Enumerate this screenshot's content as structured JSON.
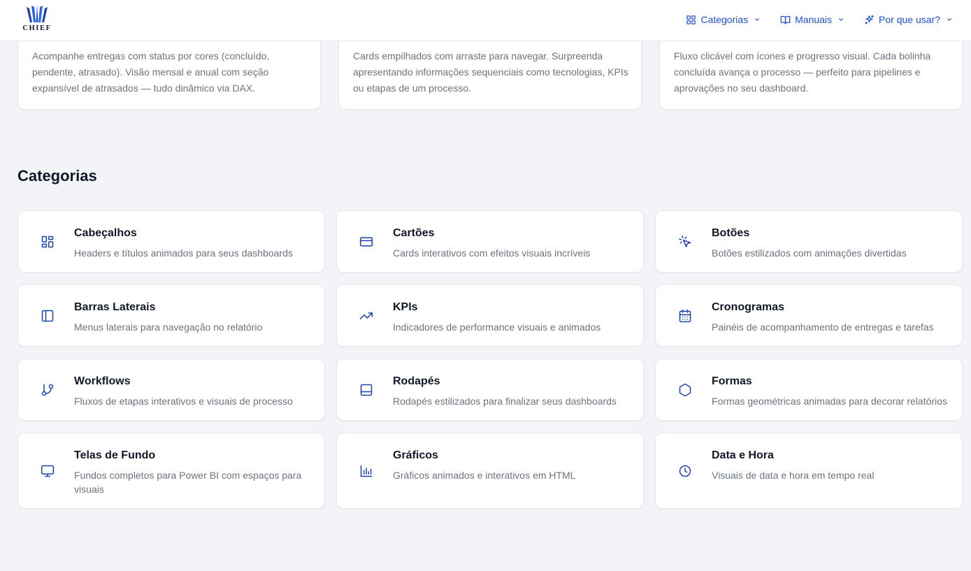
{
  "brand": {
    "name": "CHIEF",
    "color": "#1d4ed8"
  },
  "nav": {
    "items": [
      {
        "label": "Categorias",
        "icon": "grid-icon"
      },
      {
        "label": "Manuais",
        "icon": "book-open-icon"
      },
      {
        "label": "Por que usar?",
        "icon": "sparkles-icon"
      }
    ]
  },
  "features": [
    {
      "text": "Acompanhe entregas com status por cores (concluído, pendente, atrasado). Visão mensal e anual com seção expansível de atrasados — tudo dinâmico via DAX."
    },
    {
      "text": "Cards empilhados com arraste para navegar. Surpreenda apresentando informações sequenciais como tecnologias, KPIs ou etapas de um processo."
    },
    {
      "text": "Fluxo clicável com ícones e progresso visual. Cada bolinha concluída avança o processo — perfeito para pipelines e aprovações no seu dashboard."
    }
  ],
  "categories_title": "Categorias",
  "categories": [
    {
      "title": "Cabeçalhos",
      "desc": "Headers e títulos animados para seus dashboards",
      "icon": "layout-grid-icon"
    },
    {
      "title": "Cartões",
      "desc": "Cards interativos com efeitos visuais incríveis",
      "icon": "credit-card-icon"
    },
    {
      "title": "Botões",
      "desc": "Botões estilizados com animações divertidas",
      "icon": "mouse-pointer-click-icon"
    },
    {
      "title": "Barras Laterais",
      "desc": "Menus laterais para navegação no relatório",
      "icon": "panel-left-icon"
    },
    {
      "title": "KPIs",
      "desc": "Indicadores de performance visuais e animados",
      "icon": "trending-up-icon"
    },
    {
      "title": "Cronogramas",
      "desc": "Painéis de acompanhamento de entregas e tarefas",
      "icon": "calendar-icon"
    },
    {
      "title": "Workflows",
      "desc": "Fluxos de etapas interativos e visuais de processo",
      "icon": "git-branch-icon"
    },
    {
      "title": "Rodapés",
      "desc": "Rodapés estilizados para finalizar seus dashboards",
      "icon": "panel-bottom-icon"
    },
    {
      "title": "Formas",
      "desc": "Formas geométricas animadas para decorar relatórios",
      "icon": "hexagon-icon"
    },
    {
      "title": "Telas de Fundo",
      "desc": "Fundos completos para Power BI com espaços para visuais",
      "icon": "monitor-icon"
    },
    {
      "title": "Gráficos",
      "desc": "Gráficos animados e interativos em HTML",
      "icon": "bar-chart-icon"
    },
    {
      "title": "Data e Hora",
      "desc": "Visuais de data e hora em tempo real",
      "icon": "clock-icon"
    }
  ]
}
